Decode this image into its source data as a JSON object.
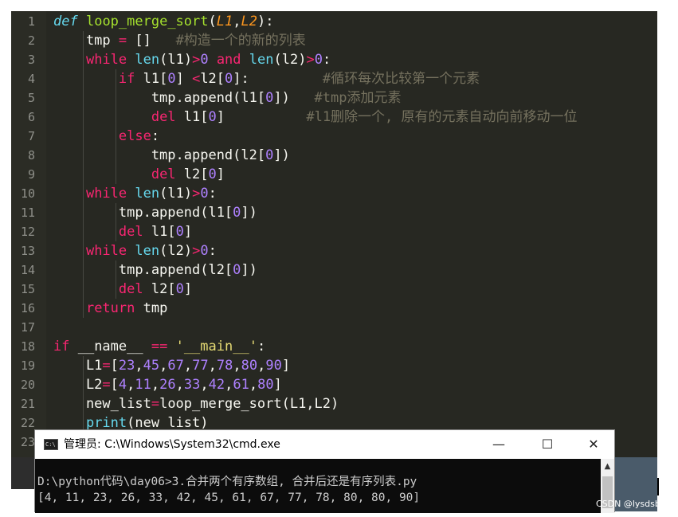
{
  "editor": {
    "line_numbers": [
      "1",
      "2",
      "3",
      "4",
      "5",
      "6",
      "7",
      "8",
      "9",
      "10",
      "11",
      "12",
      "13",
      "14",
      "15",
      "16",
      "17",
      "18",
      "19",
      "20",
      "21",
      "22",
      "23"
    ],
    "lines": [
      [
        [
          "def",
          "def"
        ],
        [
          "pl",
          " "
        ],
        [
          "fn",
          "loop_merge_sort"
        ],
        [
          "pl",
          "("
        ],
        [
          "par",
          "L1"
        ],
        [
          "pl",
          ","
        ],
        [
          "par",
          "L2"
        ],
        [
          "pl",
          "):"
        ]
      ],
      [
        [
          "pl",
          "    tmp "
        ],
        [
          "kw",
          "="
        ],
        [
          "pl",
          " []   "
        ],
        [
          "cmt",
          "#构造一个的新的列表"
        ]
      ],
      [
        [
          "pl",
          "    "
        ],
        [
          "kw",
          "while"
        ],
        [
          "pl",
          " "
        ],
        [
          "bi",
          "len"
        ],
        [
          "pl",
          "(l1)"
        ],
        [
          "kw",
          ">"
        ],
        [
          "num",
          "0"
        ],
        [
          "pl",
          " "
        ],
        [
          "kw",
          "and"
        ],
        [
          "pl",
          " "
        ],
        [
          "bi",
          "len"
        ],
        [
          "pl",
          "(l2)"
        ],
        [
          "kw",
          ">"
        ],
        [
          "num",
          "0"
        ],
        [
          "pl",
          ":"
        ]
      ],
      [
        [
          "pl",
          "        "
        ],
        [
          "kw",
          "if"
        ],
        [
          "pl",
          " l1["
        ],
        [
          "num",
          "0"
        ],
        [
          "pl",
          "] "
        ],
        [
          "kw",
          "<"
        ],
        [
          "pl",
          "l2["
        ],
        [
          "num",
          "0"
        ],
        [
          "pl",
          "]:         "
        ],
        [
          "cmt",
          "#循环每次比较第一个元素"
        ]
      ],
      [
        [
          "pl",
          "            tmp.append(l1["
        ],
        [
          "num",
          "0"
        ],
        [
          "pl",
          "])   "
        ],
        [
          "cmt",
          "#tmp添加元素"
        ]
      ],
      [
        [
          "pl",
          "            "
        ],
        [
          "kw",
          "del"
        ],
        [
          "pl",
          " l1["
        ],
        [
          "num",
          "0"
        ],
        [
          "pl",
          "]          "
        ],
        [
          "cmt",
          "#l1删除一个, 原有的元素自动向前移动一位"
        ]
      ],
      [
        [
          "pl",
          "        "
        ],
        [
          "kw",
          "else"
        ],
        [
          "pl",
          ":"
        ]
      ],
      [
        [
          "pl",
          "            tmp.append(l2["
        ],
        [
          "num",
          "0"
        ],
        [
          "pl",
          "])"
        ]
      ],
      [
        [
          "pl",
          "            "
        ],
        [
          "kw",
          "del"
        ],
        [
          "pl",
          " l2["
        ],
        [
          "num",
          "0"
        ],
        [
          "pl",
          "]"
        ]
      ],
      [
        [
          "pl",
          "    "
        ],
        [
          "kw",
          "while"
        ],
        [
          "pl",
          " "
        ],
        [
          "bi",
          "len"
        ],
        [
          "pl",
          "(l1)"
        ],
        [
          "kw",
          ">"
        ],
        [
          "num",
          "0"
        ],
        [
          "pl",
          ":"
        ]
      ],
      [
        [
          "pl",
          "        tmp.append(l1["
        ],
        [
          "num",
          "0"
        ],
        [
          "pl",
          "])"
        ]
      ],
      [
        [
          "pl",
          "        "
        ],
        [
          "kw",
          "del"
        ],
        [
          "pl",
          " l1["
        ],
        [
          "num",
          "0"
        ],
        [
          "pl",
          "]"
        ]
      ],
      [
        [
          "pl",
          "    "
        ],
        [
          "kw",
          "while"
        ],
        [
          "pl",
          " "
        ],
        [
          "bi",
          "len"
        ],
        [
          "pl",
          "(l2)"
        ],
        [
          "kw",
          ">"
        ],
        [
          "num",
          "0"
        ],
        [
          "pl",
          ":"
        ]
      ],
      [
        [
          "pl",
          "        tmp.append(l2["
        ],
        [
          "num",
          "0"
        ],
        [
          "pl",
          "])"
        ]
      ],
      [
        [
          "pl",
          "        "
        ],
        [
          "kw",
          "del"
        ],
        [
          "pl",
          " l2["
        ],
        [
          "num",
          "0"
        ],
        [
          "pl",
          "]"
        ]
      ],
      [
        [
          "pl",
          "    "
        ],
        [
          "kw",
          "return"
        ],
        [
          "pl",
          " tmp"
        ]
      ],
      [],
      [
        [
          "kw",
          "if"
        ],
        [
          "pl",
          " __name__ "
        ],
        [
          "kw",
          "=="
        ],
        [
          "pl",
          " "
        ],
        [
          "str",
          "'__main__'"
        ],
        [
          "pl",
          ":"
        ]
      ],
      [
        [
          "pl",
          "    L1"
        ],
        [
          "kw",
          "="
        ],
        [
          "pl",
          "["
        ],
        [
          "num",
          "23"
        ],
        [
          "pl",
          ","
        ],
        [
          "num",
          "45"
        ],
        [
          "pl",
          ","
        ],
        [
          "num",
          "67"
        ],
        [
          "pl",
          ","
        ],
        [
          "num",
          "77"
        ],
        [
          "pl",
          ","
        ],
        [
          "num",
          "78"
        ],
        [
          "pl",
          ","
        ],
        [
          "num",
          "80"
        ],
        [
          "pl",
          ","
        ],
        [
          "num",
          "90"
        ],
        [
          "pl",
          "]"
        ]
      ],
      [
        [
          "pl",
          "    L2"
        ],
        [
          "kw",
          "="
        ],
        [
          "pl",
          "["
        ],
        [
          "num",
          "4"
        ],
        [
          "pl",
          ","
        ],
        [
          "num",
          "11"
        ],
        [
          "pl",
          ","
        ],
        [
          "num",
          "26"
        ],
        [
          "pl",
          ","
        ],
        [
          "num",
          "33"
        ],
        [
          "pl",
          ","
        ],
        [
          "num",
          "42"
        ],
        [
          "pl",
          ","
        ],
        [
          "num",
          "61"
        ],
        [
          "pl",
          ","
        ],
        [
          "num",
          "80"
        ],
        [
          "pl",
          "]"
        ]
      ],
      [
        [
          "pl",
          "    new_list"
        ],
        [
          "kw",
          "="
        ],
        [
          "pl",
          "loop_merge_sort(L1,L2)"
        ]
      ],
      [
        [
          "pl",
          "    "
        ],
        [
          "bi",
          "print"
        ],
        [
          "pl",
          "(new_list)"
        ]
      ],
      []
    ]
  },
  "cmd": {
    "title": "管理员: C:\\Windows\\System32\\cmd.exe",
    "app_icon_text": "C:\\",
    "minimize_label": "—",
    "maximize_label": "☐",
    "close_label": "✕",
    "scroll_up_label": "▲",
    "output_lines": [
      "D:\\python代码\\day06>3.合并两个有序数组, 合并后还是有序列表.py",
      "[4, 11, 23, 26, 33, 42, 45, 61, 67, 77, 78, 80, 80, 90]"
    ]
  },
  "watermark": "CSDN @lysdsb."
}
